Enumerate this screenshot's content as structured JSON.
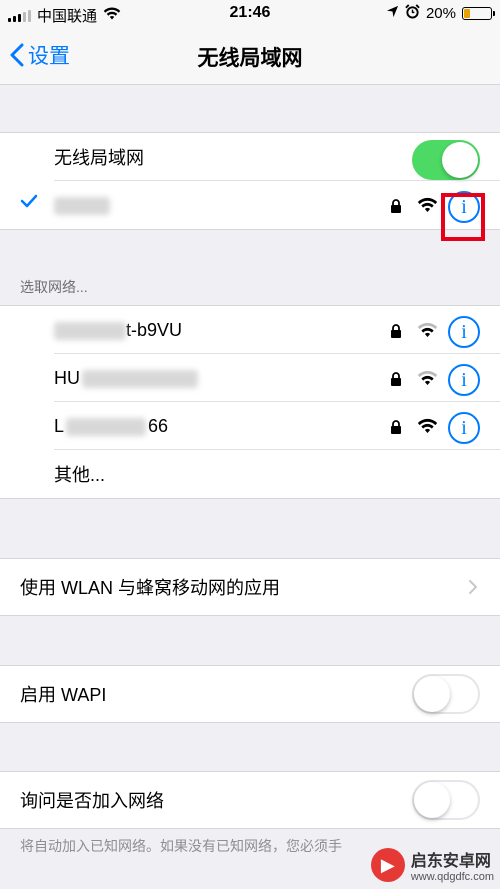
{
  "status_bar": {
    "carrier": "中国联通",
    "time": "21:46",
    "battery_percent": "20%",
    "battery_level": 0.2,
    "icons": [
      "signal-icon",
      "wifi-icon",
      "location-arrow-icon",
      "alarm-icon",
      "battery-icon"
    ]
  },
  "nav": {
    "back_label": "设置",
    "title": "无线局域网"
  },
  "wlan_toggle": {
    "label": "无线局域网",
    "on": true
  },
  "connected_network": {
    "name": "",
    "secured": true
  },
  "networks_section": {
    "header": "选取网络...",
    "networks": [
      {
        "name_visible": "t-b9VU"
      },
      {
        "name_visible": "HU"
      },
      {
        "name_visible": "L",
        "name_suffix": "66"
      }
    ],
    "other_label": "其他..."
  },
  "apps_row": {
    "label": "使用 WLAN 与蜂窝移动网的应用"
  },
  "wapi": {
    "label": "启用 WAPI",
    "on": false
  },
  "ask_join": {
    "label": "询问是否加入网络",
    "on": false
  },
  "footer_text": "将自动加入已知网络。如果没有已知网络，您必须手",
  "watermark": {
    "title": "启东安卓网",
    "url": "www.qdgdfc.com"
  },
  "colors": {
    "accent": "#007aff",
    "toggle_on": "#4cd964",
    "highlight": "#e8001a",
    "background": "#efeff4"
  }
}
